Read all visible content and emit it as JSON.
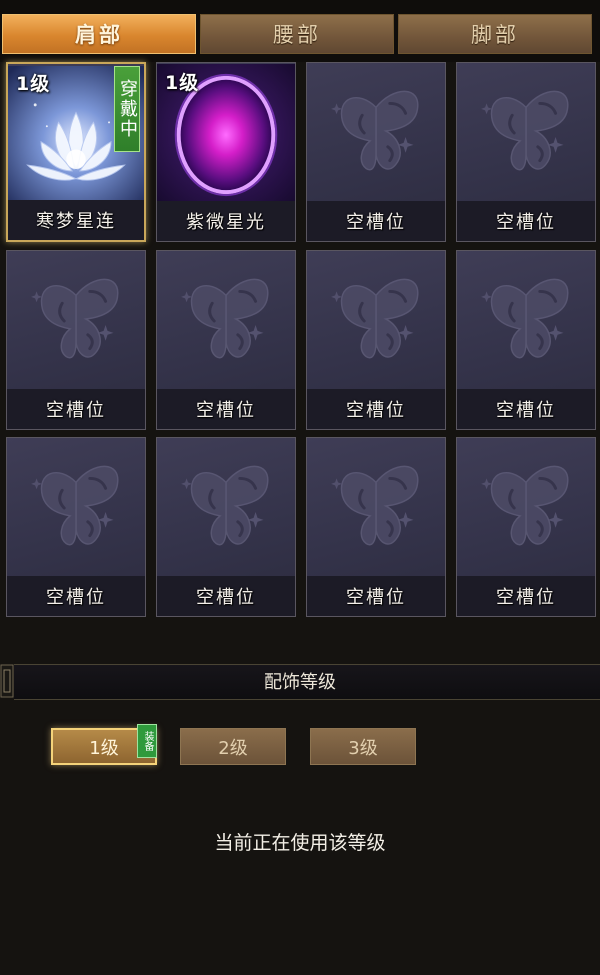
{
  "tabs": [
    {
      "label": "肩部",
      "active": true
    },
    {
      "label": "腰部",
      "active": false
    },
    {
      "label": "脚部",
      "active": false
    }
  ],
  "slots": [
    {
      "name": "寒梦星连",
      "level": "1级",
      "badge": "穿戴中",
      "state": "equipped",
      "icon": "lotus-icon"
    },
    {
      "name": "紫微星光",
      "level": "1级",
      "badge": "",
      "state": "owned",
      "icon": "purple-orb-icon"
    },
    {
      "name": "空槽位",
      "state": "empty",
      "icon": "butterfly-icon"
    },
    {
      "name": "空槽位",
      "state": "empty",
      "icon": "butterfly-icon"
    },
    {
      "name": "空槽位",
      "state": "empty",
      "icon": "butterfly-icon"
    },
    {
      "name": "空槽位",
      "state": "empty",
      "icon": "butterfly-icon"
    },
    {
      "name": "空槽位",
      "state": "empty",
      "icon": "butterfly-icon"
    },
    {
      "name": "空槽位",
      "state": "empty",
      "icon": "butterfly-icon"
    },
    {
      "name": "空槽位",
      "state": "empty",
      "icon": "butterfly-icon"
    },
    {
      "name": "空槽位",
      "state": "empty",
      "icon": "butterfly-icon"
    },
    {
      "name": "空槽位",
      "state": "empty",
      "icon": "butterfly-icon"
    },
    {
      "name": "空槽位",
      "state": "empty",
      "icon": "butterfly-icon"
    }
  ],
  "level_section": {
    "title": "配饰等级",
    "buttons": [
      {
        "label": "1级",
        "active": true
      },
      {
        "label": "2级",
        "active": false
      },
      {
        "label": "3级",
        "active": false
      }
    ],
    "equip_tag": "装备",
    "status": "当前正在使用该等级"
  },
  "colors": {
    "accent_gold": "#c9a75a",
    "tab_active": "#d9862e",
    "badge_green": "#2f7f2a"
  }
}
